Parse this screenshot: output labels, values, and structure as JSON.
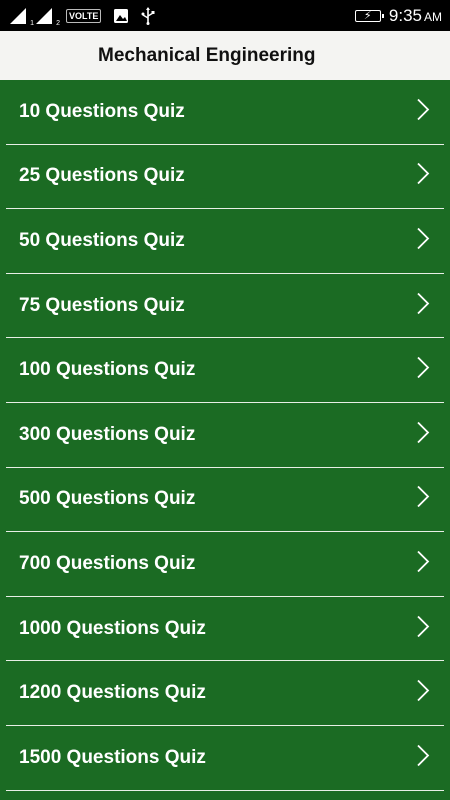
{
  "status_bar": {
    "sim1_label": "1",
    "sim2_label": "2",
    "volte": "VOLTE",
    "time": "9:35",
    "ampm": "AM"
  },
  "app_bar": {
    "title": "Mechanical Engineering"
  },
  "quiz_list": {
    "items": [
      {
        "label": "10 Questions Quiz"
      },
      {
        "label": "25 Questions Quiz"
      },
      {
        "label": "50 Questions Quiz"
      },
      {
        "label": "75 Questions Quiz"
      },
      {
        "label": "100 Questions Quiz"
      },
      {
        "label": "300 Questions Quiz"
      },
      {
        "label": "500 Questions Quiz"
      },
      {
        "label": "700 Questions Quiz"
      },
      {
        "label": "1000 Questions Quiz"
      },
      {
        "label": "1200 Questions Quiz"
      },
      {
        "label": "1500 Questions Quiz"
      }
    ]
  },
  "colors": {
    "list_background": "#1b6b23",
    "app_bar_background": "#f4f4f2",
    "status_bar_background": "#000000"
  }
}
